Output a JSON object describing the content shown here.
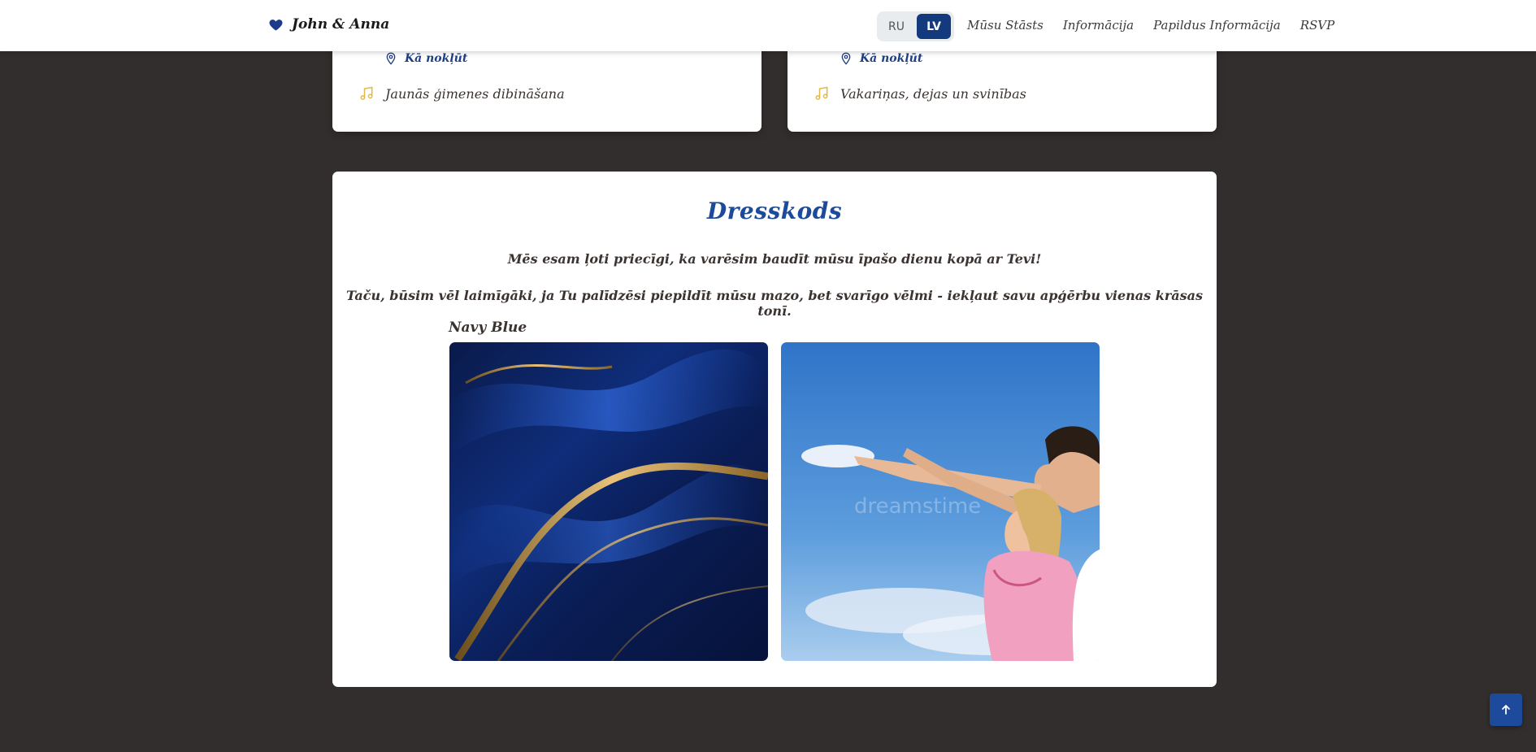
{
  "header": {
    "brand": "John & Anna",
    "languages": [
      {
        "label": "RU",
        "active": false
      },
      {
        "label": "LV",
        "active": true
      }
    ],
    "nav": [
      "Mūsu Stāsts",
      "Informācija",
      "Papildus Informācija",
      "RSVP"
    ]
  },
  "schedule": {
    "left": {
      "location_link": "Kā nokļūt",
      "event": "Jaunās ģimenes dibināšana"
    },
    "right": {
      "location_link": "Kā nokļūt",
      "event": "Vakariņas, dejas un svinības"
    }
  },
  "dress_code": {
    "title": "Dresskods",
    "line1": "Mēs esam ļoti priecīgi, ka varēsim baudīt mūsu īpašo dienu kopā ar Tevi!",
    "line2": "Taču, būsim vēl laimīgāki, ja Tu palīdzēsi piepildīt mūsu mazo, bet svarīgo vēlmi - iekļaut savu apģērbu vienas krāsas tonī.",
    "color_name": "Navy Blue"
  },
  "colors": {
    "accent": "#1e4a9c",
    "navy": "#123a7c",
    "gold": "#e0b94a",
    "background": "#322e2d"
  },
  "icons": {
    "brand": "heart-icon",
    "location": "map-pin-icon",
    "event": "music-note-icon",
    "scroll_top": "arrow-up-icon"
  }
}
